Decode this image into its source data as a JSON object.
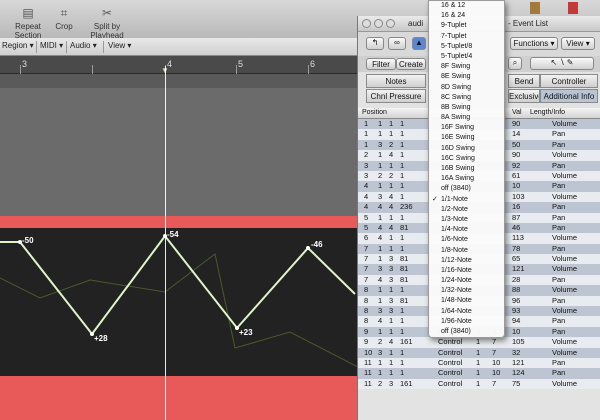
{
  "toolbar": {
    "buttons": [
      {
        "label": "Repeat Section",
        "icon": "repeat-icon"
      },
      {
        "label": "Crop",
        "icon": "crop-icon"
      },
      {
        "label": "Split by Playhead",
        "icon": "split-icon"
      }
    ]
  },
  "menubar": {
    "items": [
      "Region",
      "MIDI",
      "Audio",
      "View"
    ]
  },
  "ruler": {
    "bars": [
      "3",
      "4",
      "5",
      "6"
    ]
  },
  "automation": {
    "points": [
      {
        "label": "-50"
      },
      {
        "label": "+28"
      },
      {
        "label": "-54"
      },
      {
        "label": "+23"
      },
      {
        "label": "-46"
      }
    ]
  },
  "event_window": {
    "title_left": "audi",
    "title_right": "- Event List",
    "functions_label": "Functions",
    "view_label": "View",
    "filter_tab": "Filter",
    "create_tab": "Create",
    "type_buttons": {
      "notes": "Notes",
      "chnl_pressure": "Chnl Pressure",
      "bend": "Bend",
      "controller": "Controller",
      "exclusive": "Exclusive",
      "additional_info": "Additional Info"
    },
    "columns": {
      "position": "Position",
      "val": "Val",
      "length_info": "Length/Info"
    },
    "rows": [
      {
        "p1": "1",
        "p2": "1",
        "p3": "1",
        "p4": "1",
        "st": "",
        "ch": "",
        "num": "",
        "val": "90",
        "info": "Volume"
      },
      {
        "p1": "1",
        "p2": "1",
        "p3": "1",
        "p4": "1",
        "st": "",
        "ch": "",
        "num": "",
        "val": "14",
        "info": "Pan"
      },
      {
        "p1": "1",
        "p2": "3",
        "p3": "2",
        "p4": "1",
        "st": "",
        "ch": "",
        "num": "",
        "val": "50",
        "info": "Pan"
      },
      {
        "p1": "2",
        "p2": "1",
        "p3": "4",
        "p4": "1",
        "st": "",
        "ch": "",
        "num": "",
        "val": "90",
        "info": "Volume"
      },
      {
        "p1": "3",
        "p2": "1",
        "p3": "1",
        "p4": "1",
        "st": "",
        "ch": "",
        "num": "",
        "val": "92",
        "info": "Pan"
      },
      {
        "p1": "3",
        "p2": "2",
        "p3": "2",
        "p4": "1",
        "st": "",
        "ch": "",
        "num": "",
        "val": "61",
        "info": "Volume"
      },
      {
        "p1": "4",
        "p2": "1",
        "p3": "1",
        "p4": "1",
        "st": "",
        "ch": "",
        "num": "",
        "val": "10",
        "info": "Pan"
      },
      {
        "p1": "4",
        "p2": "3",
        "p3": "4",
        "p4": "1",
        "st": "",
        "ch": "",
        "num": "",
        "val": "103",
        "info": "Volume"
      },
      {
        "p1": "4",
        "p2": "4",
        "p3": "4",
        "p4": "236",
        "st": "",
        "ch": "",
        "num": "",
        "val": "16",
        "info": "Pan"
      },
      {
        "p1": "5",
        "p2": "1",
        "p3": "1",
        "p4": "1",
        "st": "",
        "ch": "",
        "num": "",
        "val": "87",
        "info": "Pan"
      },
      {
        "p1": "5",
        "p2": "4",
        "p3": "4",
        "p4": "81",
        "st": "",
        "ch": "",
        "num": "",
        "val": "46",
        "info": "Pan"
      },
      {
        "p1": "6",
        "p2": "4",
        "p3": "1",
        "p4": "1",
        "st": "",
        "ch": "",
        "num": "",
        "val": "113",
        "info": "Volume"
      },
      {
        "p1": "7",
        "p2": "1",
        "p3": "1",
        "p4": "1",
        "st": "",
        "ch": "",
        "num": "",
        "val": "78",
        "info": "Pan"
      },
      {
        "p1": "7",
        "p2": "1",
        "p3": "3",
        "p4": "81",
        "st": "",
        "ch": "",
        "num": "",
        "val": "65",
        "info": "Volume"
      },
      {
        "p1": "7",
        "p2": "3",
        "p3": "3",
        "p4": "81",
        "st": "",
        "ch": "",
        "num": "",
        "val": "121",
        "info": "Volume"
      },
      {
        "p1": "7",
        "p2": "4",
        "p3": "3",
        "p4": "81",
        "st": "",
        "ch": "",
        "num": "",
        "val": "28",
        "info": "Pan"
      },
      {
        "p1": "8",
        "p2": "1",
        "p3": "1",
        "p4": "1",
        "st": "",
        "ch": "",
        "num": "",
        "val": "88",
        "info": "Volume"
      },
      {
        "p1": "8",
        "p2": "1",
        "p3": "3",
        "p4": "81",
        "st": "",
        "ch": "",
        "num": "",
        "val": "96",
        "info": "Pan"
      },
      {
        "p1": "8",
        "p2": "3",
        "p3": "3",
        "p4": "1",
        "st": "",
        "ch": "",
        "num": "",
        "val": "93",
        "info": "Volume"
      },
      {
        "p1": "8",
        "p2": "4",
        "p3": "1",
        "p4": "1",
        "st": "",
        "ch": "",
        "num": "",
        "val": "94",
        "info": "Pan"
      },
      {
        "p1": "9",
        "p2": "1",
        "p3": "1",
        "p4": "1",
        "st": "Control",
        "ch": "1",
        "num": "10",
        "val": "10",
        "info": "Pan"
      },
      {
        "p1": "9",
        "p2": "2",
        "p3": "4",
        "p4": "161",
        "st": "Control",
        "ch": "1",
        "num": "7",
        "val": "105",
        "info": "Volume"
      },
      {
        "p1": "10",
        "p2": "3",
        "p3": "1",
        "p4": "1",
        "st": "Control",
        "ch": "1",
        "num": "7",
        "val": "32",
        "info": "Volume"
      },
      {
        "p1": "11",
        "p2": "1",
        "p3": "1",
        "p4": "1",
        "st": "Control",
        "ch": "1",
        "num": "10",
        "val": "121",
        "info": "Pan"
      },
      {
        "p1": "11",
        "p2": "1",
        "p3": "1",
        "p4": "1",
        "st": "Control",
        "ch": "1",
        "num": "10",
        "val": "124",
        "info": "Pan"
      },
      {
        "p1": "11",
        "p2": "2",
        "p3": "3",
        "p4": "161",
        "st": "Control",
        "ch": "1",
        "num": "7",
        "val": "75",
        "info": "Volume"
      }
    ]
  },
  "dropdown": {
    "items": [
      {
        "label": "16 & 12",
        "checked": false
      },
      {
        "label": "16 & 24",
        "checked": false
      },
      {
        "label": "9-Tuplet",
        "checked": false
      },
      {
        "label": "7-Tuplet",
        "checked": false
      },
      {
        "label": "5-Tuplet/8",
        "checked": false
      },
      {
        "label": "5-Tuplet/4",
        "checked": false
      },
      {
        "label": "8F Swing",
        "checked": false
      },
      {
        "label": "8E Swing",
        "checked": false
      },
      {
        "label": "8D Swing",
        "checked": false
      },
      {
        "label": "8C Swing",
        "checked": false
      },
      {
        "label": "8B Swing",
        "checked": false
      },
      {
        "label": "8A Swing",
        "checked": false
      },
      {
        "label": "16F Swing",
        "checked": false
      },
      {
        "label": "16E Swing",
        "checked": false
      },
      {
        "label": "16D Swing",
        "checked": false
      },
      {
        "label": "16C Swing",
        "checked": false
      },
      {
        "label": "16B Swing",
        "checked": false
      },
      {
        "label": "16A Swing",
        "checked": false
      },
      {
        "label": "off (3840)",
        "checked": false
      },
      {
        "label": "1/1-Note",
        "checked": true
      },
      {
        "label": "1/2-Note",
        "checked": false
      },
      {
        "label": "1/3-Note",
        "checked": false
      },
      {
        "label": "1/4-Note",
        "checked": false
      },
      {
        "label": "1/6-Note",
        "checked": false
      },
      {
        "label": "1/8-Note",
        "checked": false
      },
      {
        "label": "1/12-Note",
        "checked": false
      },
      {
        "label": "1/16-Note",
        "checked": false
      },
      {
        "label": "1/24-Note",
        "checked": false
      },
      {
        "label": "1/32-Note",
        "checked": false
      },
      {
        "label": "1/48-Note",
        "checked": false
      },
      {
        "label": "1/64-Note",
        "checked": false
      },
      {
        "label": "1/96-Note",
        "checked": false
      },
      {
        "label": "off (3840)",
        "checked": false
      }
    ]
  },
  "colors": {
    "region_red": "#e85a5a",
    "automation_line": "#dff5c8",
    "selection_blue": "#bcc5d1"
  }
}
